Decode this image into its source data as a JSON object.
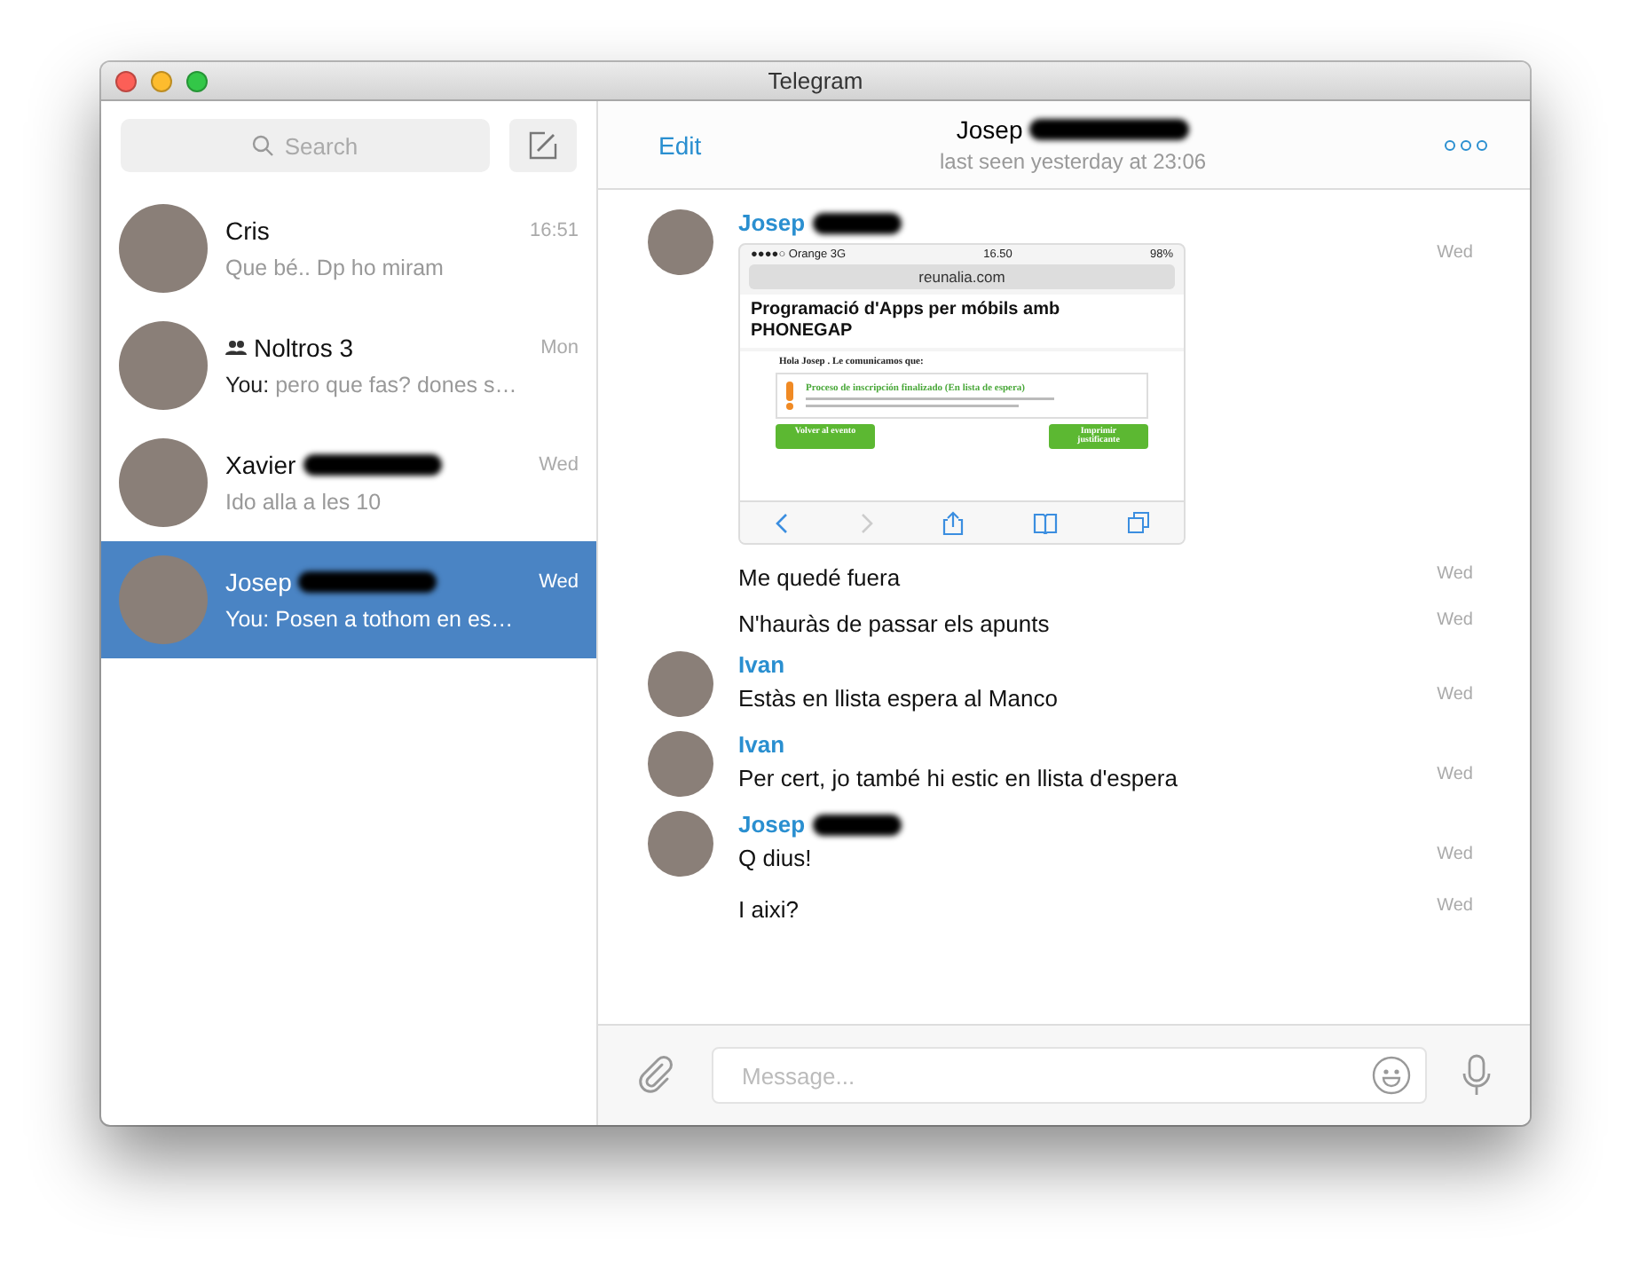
{
  "window": {
    "title": "Telegram"
  },
  "sidebar": {
    "search": {
      "placeholder": "Search"
    },
    "chats": [
      {
        "name": "Cris",
        "redacted": false,
        "group": false,
        "time": "16:51",
        "preview": "Que bé.. Dp ho miram",
        "selected": false
      },
      {
        "name": "Noltros 3",
        "redacted": false,
        "group": true,
        "time": "Mon",
        "sender": "You:",
        "preview": "pero que fas? dones s…",
        "selected": false
      },
      {
        "name": "Xavier",
        "redacted": true,
        "group": false,
        "time": "Wed",
        "preview": "Ido alla a les 10",
        "selected": false
      },
      {
        "name": "Josep",
        "redacted": true,
        "group": false,
        "time": "Wed",
        "sender": "You:",
        "preview": "Posen a tothom en es…",
        "selected": true
      }
    ]
  },
  "header": {
    "edit": "Edit",
    "name": "Josep",
    "redacted": true,
    "status": "last seen yesterday at 23:06"
  },
  "messages": [
    {
      "kind": "image",
      "author": "Josep",
      "redacted": true,
      "time": "Wed",
      "shot": {
        "carrier": "●●●●○ Orange  3G",
        "clock": "16.50",
        "battery": "98%",
        "url": "reunalia.com",
        "heading": "Programació d'Apps per móbils amb PHONEGAP",
        "greeting": "Hola Josep . Le comunicamos que:",
        "notice": "Proceso de inscripción finalizado (En lista de espera)",
        "buttons": [
          "Volver al evento",
          "Imprimir justificante"
        ]
      }
    },
    {
      "kind": "text",
      "text": "Me quedé fuera",
      "time": "Wed"
    },
    {
      "kind": "text",
      "text": "N'hauràs de passar els apunts",
      "time": "Wed"
    },
    {
      "kind": "text",
      "author": "Ivan",
      "redacted": false,
      "text": "Estàs en llista espera al Manco",
      "time": "Wed"
    },
    {
      "kind": "text",
      "author": "Ivan",
      "redacted": false,
      "text": "Per cert, jo també hi estic en llista d'espera",
      "time": "Wed"
    },
    {
      "kind": "text",
      "author": "Josep",
      "redacted": true,
      "text": "Q dius!",
      "time": "Wed"
    },
    {
      "kind": "text",
      "text": "I aixi?",
      "time": "Wed"
    }
  ],
  "composer": {
    "placeholder": "Message..."
  }
}
